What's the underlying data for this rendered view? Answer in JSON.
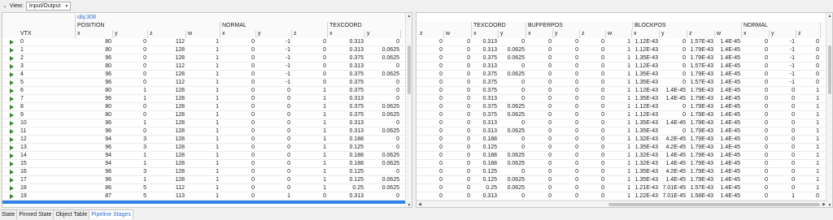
{
  "toolbar": {
    "view_label": "View:",
    "view_value": "Input/Output"
  },
  "left": {
    "object": "obj:308",
    "groups": [
      "POSITION",
      "NORMAL",
      "TEXCOORD"
    ],
    "columns": [
      "VTX",
      "x",
      "y",
      "z",
      "w",
      "x",
      "y",
      "z",
      "x",
      "y"
    ],
    "rows": [
      [
        "0",
        "80",
        "0",
        "112",
        "1",
        "0",
        "-1",
        "0",
        "0.313",
        "0"
      ],
      [
        "1",
        "80",
        "0",
        "128",
        "1",
        "0",
        "-1",
        "0",
        "0.313",
        "0.0625"
      ],
      [
        "2",
        "96",
        "0",
        "128",
        "1",
        "0",
        "-1",
        "0",
        "0.375",
        "0.0625"
      ],
      [
        "3",
        "80",
        "0",
        "112",
        "1",
        "0",
        "-1",
        "0",
        "0.313",
        "0"
      ],
      [
        "4",
        "96",
        "0",
        "128",
        "1",
        "0",
        "-1",
        "0",
        "0.375",
        "0.0625"
      ],
      [
        "5",
        "96",
        "0",
        "112",
        "1",
        "0",
        "-1",
        "0",
        "0.375",
        "0"
      ],
      [
        "6",
        "80",
        "1",
        "128",
        "1",
        "0",
        "0",
        "1",
        "0.375",
        "0"
      ],
      [
        "7",
        "96",
        "1",
        "128",
        "1",
        "0",
        "0",
        "1",
        "0.313",
        "0"
      ],
      [
        "8",
        "80",
        "0",
        "128",
        "1",
        "0",
        "0",
        "1",
        "0.375",
        "0.0625"
      ],
      [
        "9",
        "80",
        "0",
        "128",
        "1",
        "0",
        "0",
        "1",
        "0.375",
        "0.0625"
      ],
      [
        "10",
        "96",
        "1",
        "128",
        "1",
        "0",
        "0",
        "1",
        "0.313",
        "0"
      ],
      [
        "11",
        "96",
        "0",
        "128",
        "1",
        "0",
        "0",
        "1",
        "0.313",
        "0.0625"
      ],
      [
        "12",
        "94",
        "3",
        "128",
        "1",
        "0",
        "0",
        "1",
        "0.188",
        "0"
      ],
      [
        "13",
        "96",
        "3",
        "128",
        "1",
        "0",
        "0",
        "1",
        "0.125",
        "0"
      ],
      [
        "14",
        "94",
        "1",
        "128",
        "1",
        "0",
        "0",
        "1",
        "0.188",
        "0.0625"
      ],
      [
        "15",
        "94",
        "1",
        "128",
        "1",
        "0",
        "0",
        "1",
        "0.188",
        "0.0625"
      ],
      [
        "16",
        "96",
        "3",
        "128",
        "1",
        "0",
        "0",
        "1",
        "0.125",
        "0"
      ],
      [
        "17",
        "96",
        "1",
        "128",
        "1",
        "0",
        "0",
        "1",
        "0.125",
        "0.0625"
      ],
      [
        "18",
        "86",
        "5",
        "112",
        "1",
        "0",
        "0",
        "1",
        "0.25",
        "0.0625"
      ],
      [
        "19",
        "87",
        "5",
        "113",
        "1",
        "0",
        "1",
        "0",
        "0.313",
        "0"
      ]
    ]
  },
  "right": {
    "groups": [
      "TEXCOORD",
      "BUFFERPOS",
      "BLOCKPOS",
      "NORMAL"
    ],
    "columns": [
      "z",
      "w",
      "x",
      "y",
      "x",
      "y",
      "z",
      "w",
      "x",
      "y",
      "z",
      "w",
      "x",
      "y",
      "z"
    ],
    "rows": [
      [
        "0",
        "0",
        "0.313",
        "0",
        "0",
        "0",
        "0",
        "1",
        "1.12E-43",
        "0",
        "1.57E-43",
        "1.4E-45",
        "0",
        "-1",
        "0"
      ],
      [
        "0",
        "0",
        "0.313",
        "0.0625",
        "0",
        "0",
        "0",
        "1",
        "1.12E-43",
        "0",
        "1.79E-43",
        "1.4E-45",
        "0",
        "-1",
        "0"
      ],
      [
        "0",
        "0",
        "0.375",
        "0.0625",
        "0",
        "0",
        "0",
        "1",
        "1.35E-43",
        "0",
        "1.79E-43",
        "1.4E-45",
        "0",
        "-1",
        "0"
      ],
      [
        "0",
        "0",
        "0.313",
        "0",
        "0",
        "0",
        "0",
        "1",
        "1.12E-43",
        "0",
        "1.57E-43",
        "1.4E-45",
        "0",
        "-1",
        "0"
      ],
      [
        "0",
        "0",
        "0.375",
        "0.0625",
        "0",
        "0",
        "0",
        "1",
        "1.35E-43",
        "0",
        "1.79E-43",
        "1.4E-45",
        "0",
        "-1",
        "0"
      ],
      [
        "0",
        "0",
        "0.375",
        "0",
        "0",
        "0",
        "0",
        "1",
        "1.35E-43",
        "0",
        "1.57E-43",
        "1.4E-45",
        "0",
        "-1",
        "0"
      ],
      [
        "0",
        "0",
        "0.375",
        "0",
        "0",
        "0",
        "0",
        "1",
        "1.12E-43",
        "1.4E-45",
        "1.79E-43",
        "1.4E-45",
        "0",
        "0",
        "1"
      ],
      [
        "0",
        "0",
        "0.313",
        "0",
        "0",
        "0",
        "0",
        "1",
        "1.35E-43",
        "1.4E-45",
        "1.79E-43",
        "1.4E-45",
        "0",
        "0",
        "1"
      ],
      [
        "0",
        "0",
        "0.375",
        "0.0625",
        "0",
        "0",
        "0",
        "1",
        "1.12E-43",
        "0",
        "1.79E-43",
        "1.4E-45",
        "0",
        "0",
        "1"
      ],
      [
        "0",
        "0",
        "0.375",
        "0.0625",
        "0",
        "0",
        "0",
        "1",
        "1.12E-43",
        "0",
        "1.79E-43",
        "1.4E-45",
        "0",
        "0",
        "1"
      ],
      [
        "0",
        "0",
        "0.313",
        "0",
        "0",
        "0",
        "0",
        "1",
        "1.35E-43",
        "1.4E-45",
        "1.79E-43",
        "1.4E-45",
        "0",
        "0",
        "1"
      ],
      [
        "0",
        "0",
        "0.313",
        "0.0625",
        "0",
        "0",
        "0",
        "1",
        "1.35E-43",
        "0",
        "1.79E-43",
        "1.4E-45",
        "0",
        "0",
        "1"
      ],
      [
        "0",
        "0",
        "0.188",
        "0",
        "0",
        "0",
        "0",
        "1",
        "1.32E-43",
        "4.2E-45",
        "1.79E-43",
        "1.4E-45",
        "0",
        "0",
        "1"
      ],
      [
        "0",
        "0",
        "0.125",
        "0",
        "0",
        "0",
        "0",
        "1",
        "1.35E-43",
        "4.2E-45",
        "1.79E-43",
        "1.4E-45",
        "0",
        "0",
        "1"
      ],
      [
        "0",
        "0",
        "0.188",
        "0.0625",
        "0",
        "0",
        "0",
        "1",
        "1.32E-43",
        "1.4E-45",
        "1.79E-43",
        "1.4E-45",
        "0",
        "0",
        "1"
      ],
      [
        "0",
        "0",
        "0.188",
        "0.0625",
        "0",
        "0",
        "0",
        "1",
        "1.32E-43",
        "1.4E-45",
        "1.79E-43",
        "1.4E-45",
        "0",
        "0",
        "1"
      ],
      [
        "0",
        "0",
        "0.125",
        "0",
        "0",
        "0",
        "0",
        "1",
        "1.35E-43",
        "4.2E-45",
        "1.79E-43",
        "1.4E-45",
        "0",
        "0",
        "1"
      ],
      [
        "0",
        "0",
        "0.125",
        "0.0625",
        "0",
        "0",
        "0",
        "1",
        "1.35E-43",
        "1.4E-45",
        "1.79E-43",
        "1.4E-45",
        "0",
        "0",
        "1"
      ],
      [
        "0",
        "0",
        "0.25",
        "0.0625",
        "0",
        "0",
        "0",
        "1",
        "1.21E-43",
        "7.01E-45",
        "1.57E-43",
        "1.4E-45",
        "0",
        "0",
        "1"
      ],
      [
        "0",
        "0",
        "0.313",
        "0",
        "0",
        "0",
        "0",
        "1",
        "1.22E-43",
        "7.01E-45",
        "1.58E-43",
        "1.4E-45",
        "0",
        "1",
        "0"
      ]
    ]
  },
  "tabs": [
    "State",
    "Pinned State",
    "Object Table",
    "Pipeline Stages"
  ],
  "active_tab": "Pipeline Stages",
  "colors": {
    "accent": "#2a6fc9",
    "selection": "#2f80e8",
    "play": "#2c8c32"
  }
}
